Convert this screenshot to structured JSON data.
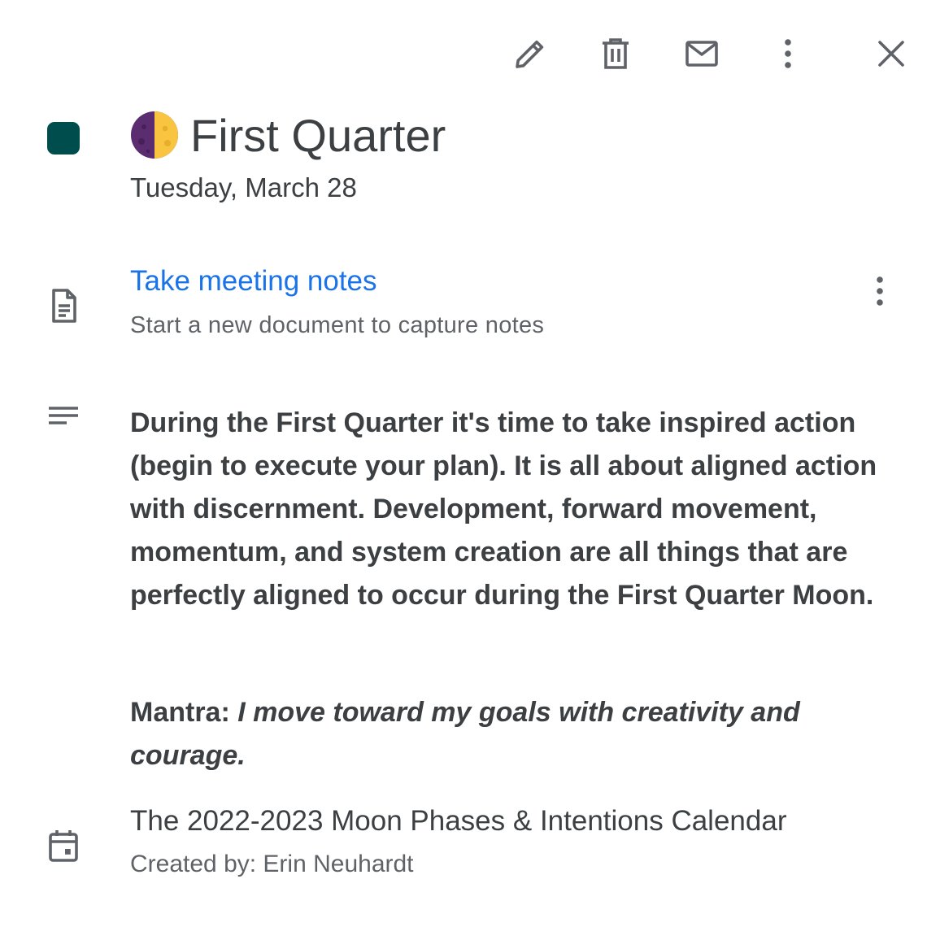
{
  "toolbar": {
    "icons": [
      "edit-icon",
      "delete-icon",
      "email-icon",
      "more-vert-icon",
      "close-icon"
    ]
  },
  "event": {
    "color": "#004d4d",
    "moon_icon": "first-quarter-moon-icon",
    "title": "First Quarter",
    "date": "Tuesday, March 28"
  },
  "notes": {
    "link_label": "Take meeting notes",
    "subtitle": "Start a new document to capture notes",
    "link_color": "#1a73e8"
  },
  "description": {
    "body": "During the First Quarter it's time to take inspired action (begin to execute your plan). It is all about aligned action with discernment. Development, forward movement, momentum, and system creation are all things that are perfectly aligned to occur during the First Quarter Moon.",
    "mantra_label": "Mantra: ",
    "mantra_text": "I move toward my goals with creativity and courage."
  },
  "calendar": {
    "name": "The 2022-2023 Moon Phases & Intentions Calendar",
    "created_by": "Created by: Erin Neuhardt"
  }
}
